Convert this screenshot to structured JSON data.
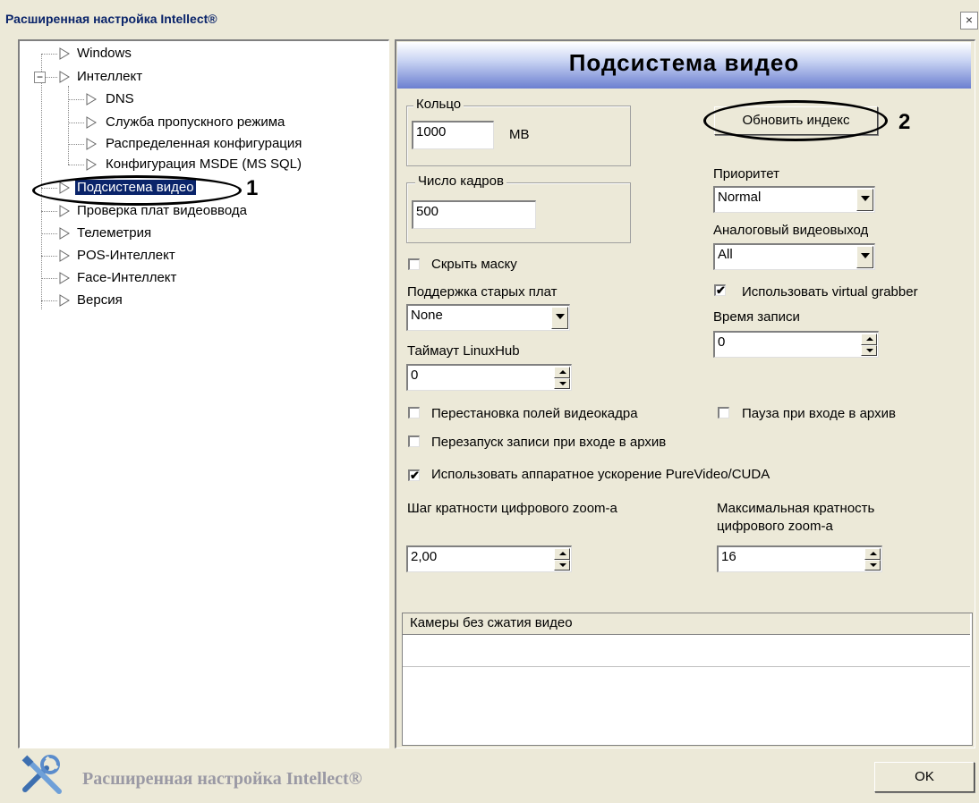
{
  "window": {
    "title": "Расширенная настройка Intellect®",
    "close": "×"
  },
  "tree": {
    "items": [
      {
        "label": "Windows"
      },
      {
        "label": "Интеллект",
        "expander": "−"
      },
      {
        "label": "DNS"
      },
      {
        "label": "Служба пропускного режима"
      },
      {
        "label": "Распределенная конфигурация"
      },
      {
        "label": "Конфигурация MSDE (MS SQL)"
      },
      {
        "label": "Подсистема видео"
      },
      {
        "label": "Проверка плат видеоввода"
      },
      {
        "label": "Телеметрия"
      },
      {
        "label": "POS-Интеллект"
      },
      {
        "label": "Face-Интеллект"
      },
      {
        "label": "Версия"
      }
    ],
    "callout": "1"
  },
  "panel": {
    "title": "Подсистема видео",
    "ring": {
      "label": "Кольцо",
      "value": "1000",
      "unit": "MB"
    },
    "frames": {
      "label": "Число кадров",
      "value": "500"
    },
    "update_index": "Обновить индекс",
    "callout": "2",
    "priority": {
      "label": "Приоритет",
      "value": "Normal"
    },
    "analog_out": {
      "label": "Аналоговый видеовыход",
      "value": "All"
    },
    "hide_mask": {
      "label": "Скрыть маску",
      "checked": false
    },
    "virtual_grabber": {
      "label": "Использовать virtual grabber",
      "checked": true
    },
    "old_boards": {
      "label": "Поддержка старых плат",
      "value": "None"
    },
    "record_time": {
      "label": "Время записи",
      "value": "0"
    },
    "linuxhub": {
      "label": "Таймаут LinuxHub",
      "value": "0"
    },
    "swap_fields": {
      "label": "Перестановка полей видеокадра",
      "checked": false
    },
    "pause_archive": {
      "label": "Пауза при входе в архив",
      "checked": false
    },
    "restart_record": {
      "label": "Перезапуск записи при входе в архив",
      "checked": false
    },
    "hw_accel": {
      "label": "Использовать аппаратное ускорение PureVideo/CUDA",
      "checked": true
    },
    "zoom_step": {
      "label": "Шаг кратности цифрового zoom-а",
      "value": "2,00"
    },
    "zoom_max": {
      "label1": "Максимальная кратность",
      "label2": "цифрового zoom-а",
      "value": "16"
    },
    "cameras_list": {
      "header": "Камеры без сжатия видео"
    }
  },
  "footer": {
    "title": "Расширенная настройка Intellect®",
    "ok": "OK"
  },
  "marks": {
    "check": "✔"
  }
}
